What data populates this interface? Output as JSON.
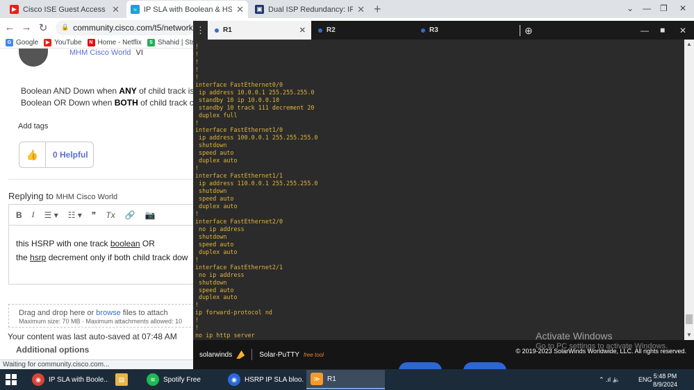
{
  "browser": {
    "tabs": [
      {
        "title": "Cisco ISE Guest Access Basics, Pa",
        "color": "#e62117",
        "glyph": "▶",
        "active": false
      },
      {
        "title": "IP SLA with Boolean & HSRP - Cis",
        "color": "#1ba0d7",
        "glyph": "≈",
        "active": true
      },
      {
        "title": "Dual ISP Redundancy: IP SLA, Bo",
        "color": "#1e3a6e",
        "glyph": "▣",
        "active": false
      }
    ],
    "close_glyph": "✕",
    "new_tab": "+",
    "window_controls": {
      "dropdown": "⌄",
      "minimize": "—",
      "restore": "❐",
      "close": "✕"
    },
    "nav": {
      "back": "←",
      "forward": "→",
      "reload": "↻"
    },
    "url": "community.cisco.com/t5/network-man",
    "bookmarks": [
      {
        "label": "Google",
        "icon": "G",
        "color": "#4285f4"
      },
      {
        "label": "YouTube",
        "icon": "▶",
        "color": "#e62117"
      },
      {
        "label": "Home - Netflix",
        "icon": "N",
        "color": "#e50914"
      },
      {
        "label": "Shahid | Stre",
        "icon": "S",
        "color": "#1fae5b"
      }
    ],
    "status": "Waiting for community.cisco.com..."
  },
  "page": {
    "author": "MHM Cisco World",
    "author_suffix": "VI",
    "line1_pre": "Boolean AND Down when ",
    "line1_bold": "ANY",
    "line1_post": " of child track is",
    "line2_pre": "Boolean OR Down when ",
    "line2_bold": "BOTH",
    "line2_post": " of child track c",
    "add_tags": "Add tags",
    "helpful": "0 Helpful",
    "replying_to": "Replying to",
    "replying_name": "MHM Cisco World",
    "toolbar": [
      "B",
      "I",
      "☰ ▾",
      "☷ ▾",
      "❞",
      "Tx",
      "🔗",
      "📷"
    ],
    "editor_line1_a": "this HSRP with one track ",
    "editor_line1_u": "boolean",
    "editor_line1_b": " OR",
    "editor_line2_a": "the ",
    "editor_line2_u": "hsrp",
    "editor_line2_b": " decrement only if both child track dow",
    "attach_a": "Drag and drop here or ",
    "attach_link": "browse",
    "attach_b": " files to attach",
    "attach_limits": "Maximum size: 70 MB · Maximum attachments allowed: 10",
    "autosaved": "Your content was last auto-saved at 07:48 AM",
    "additional_options": "Additional options"
  },
  "putty": {
    "tabs": [
      {
        "label": "R1",
        "active": true
      },
      {
        "label": "R2",
        "active": false
      },
      {
        "label": "R3",
        "active": false
      }
    ],
    "menu_icon": "⋮",
    "add_tab": "⊕",
    "controls": {
      "minimize": "—",
      "maximize": "◼",
      "close": "✕"
    },
    "terminal_lines": [
      "!",
      "!",
      "!",
      "!",
      "!",
      "interface FastEthernet0/0",
      " ip address 10.0.0.1 255.255.255.0",
      " standby 10 ip 10.0.0.10",
      " standby 10 track 111 decrement 20",
      " duplex full",
      "!",
      "interface FastEthernet1/0",
      " ip address 100.0.0.1 255.255.255.0",
      " shutdown",
      " speed auto",
      " duplex auto",
      "!",
      "interface FastEthernet1/1",
      " ip address 110.0.0.1 255.255.255.0",
      " shutdown",
      " speed auto",
      " duplex auto",
      "!",
      "interface FastEthernet2/0",
      " no ip address",
      " shutdown",
      " speed auto",
      " duplex auto",
      "!",
      "interface FastEthernet2/1",
      " no ip address",
      " shutdown",
      " speed auto",
      " duplex auto",
      "!",
      "ip forward-protocol nd",
      "!",
      "!",
      "no ip http server"
    ],
    "brand": "solarwinds",
    "product": "Solar-PuTTY",
    "product_tag": "free tool",
    "copyright": "© 2019-2023 SolarWinds Worldwide, LLC. All rights reserved.",
    "terminal_color": "#e0b43c"
  },
  "watermark": {
    "line1": "Activate Windows",
    "line2": "Go to PC settings to activate Windows."
  },
  "taskbar": {
    "apps": [
      {
        "label": "IP SLA with Boole...",
        "icon": "◉",
        "color": "#db4437",
        "active": false
      },
      {
        "label": "",
        "icon": "▤",
        "color": "#e6b54a",
        "active": false
      },
      {
        "label": "Spotify Free",
        "icon": "≋",
        "color": "#1db954",
        "active": false
      },
      {
        "label": "HSRP IP SLA bloo...",
        "icon": "◉",
        "color": "#2a6ad9",
        "active": false
      },
      {
        "label": "R1",
        "icon": "≫",
        "color": "#f39c2b",
        "active": true
      }
    ],
    "tray_icons": "⌃  .ıl  🔈",
    "language": "ENG",
    "time": "5:48 PM",
    "date": "8/9/2024"
  }
}
